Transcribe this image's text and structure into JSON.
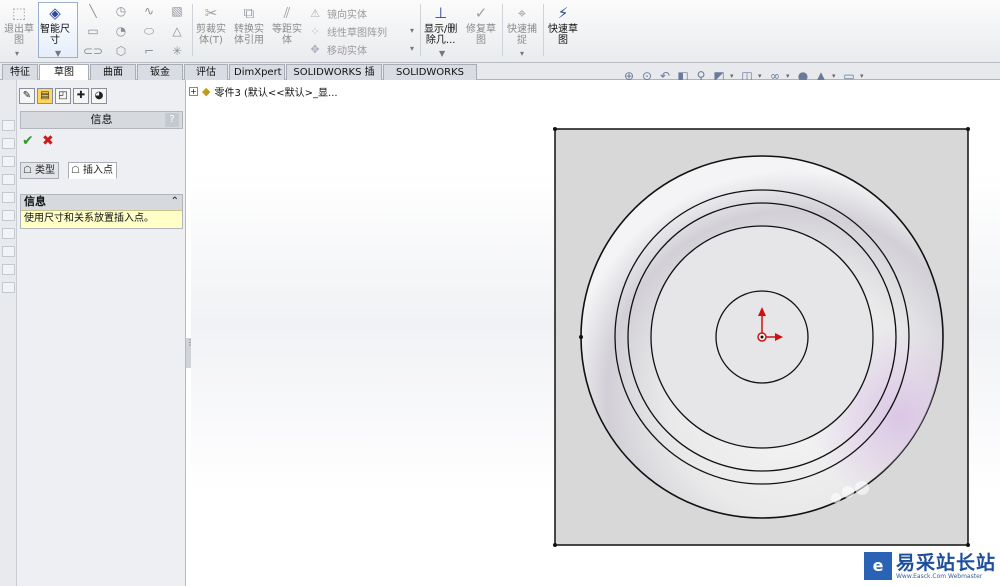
{
  "ribbon": {
    "exit_sketch": "退出草\n图",
    "smart_dim": "智能尺\n寸",
    "trim": "剪裁实\n体(T)",
    "convert": "转换实\n体引用",
    "offset": "等距实\n体",
    "mirror": "镜向实体",
    "linear_pattern": "线性草图阵列",
    "move": "移动实体",
    "display_delete": "显示/删\n除几...",
    "repair": "修复草\n图",
    "quick_snap": "快速捕\n捉",
    "rapid_sketch": "快速草\n图"
  },
  "tabs": [
    "特征",
    "草图",
    "曲面",
    "钣金",
    "评估",
    "DimXpert",
    "SOLIDWORKS 插件",
    "SOLIDWORKS MBD"
  ],
  "active_tab": "草图",
  "property_manager": {
    "title": "信息",
    "help": "?",
    "ok": "✔",
    "cancel": "✖",
    "subtab_type": "类型",
    "subtab_insert": "插入点",
    "info_header": "信息",
    "info_collapse": "⌃",
    "info_text": "使用尺寸和关系放置插入点。"
  },
  "tree": {
    "expander": "+",
    "label": "零件3 (默认<<默认>_显..."
  },
  "watermark": {
    "main": "易采站长站",
    "sub": "Www.Easck.Com Webmaster"
  },
  "colors": {
    "accent": "#2a4a9a",
    "origin": "#d01010",
    "face": "#d8d8d8"
  }
}
